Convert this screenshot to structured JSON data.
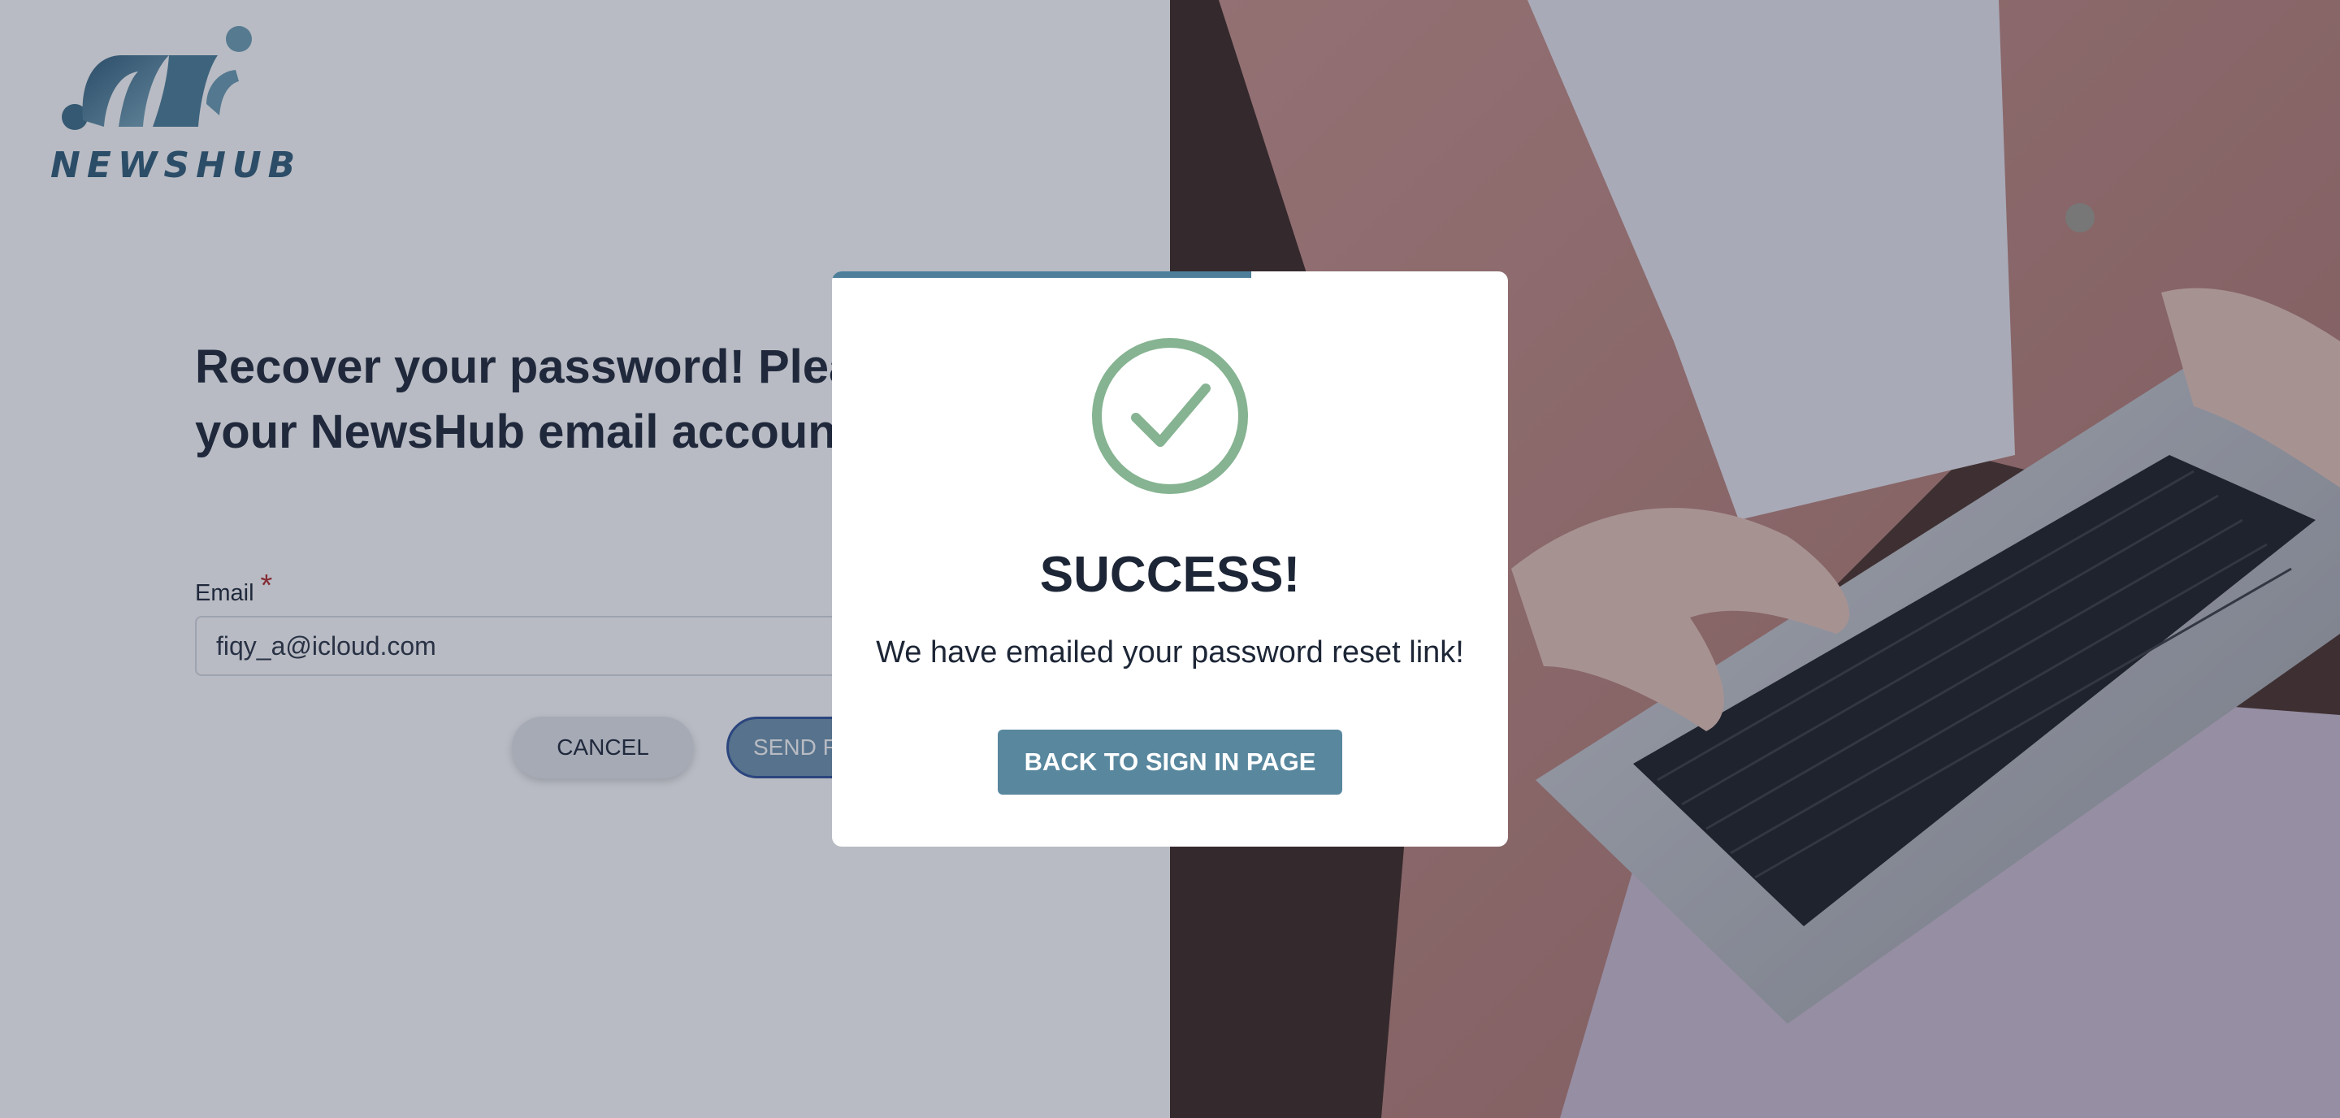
{
  "brand": {
    "name": "NEWSHUB",
    "primary_color": "#2f5b78"
  },
  "recover_form": {
    "heading": "Recover your password! Please enter your NewsHub email account",
    "email_label": "Email",
    "required_marker": "*",
    "email_value": "fiqy_a@icloud.com",
    "cancel_label": "CANCEL",
    "send_label": "SEND RESET LINK"
  },
  "modal": {
    "icon": "check-circle-icon",
    "title": "SUCCESS!",
    "message": "We have emailed your password reset link!",
    "button_label": "BACK TO SIGN IN PAGE",
    "progress": 0.62,
    "accent_color": "#58879e",
    "success_color": "#86b391"
  },
  "hero_image": {
    "icon": "person-typing-laptop-photo"
  }
}
